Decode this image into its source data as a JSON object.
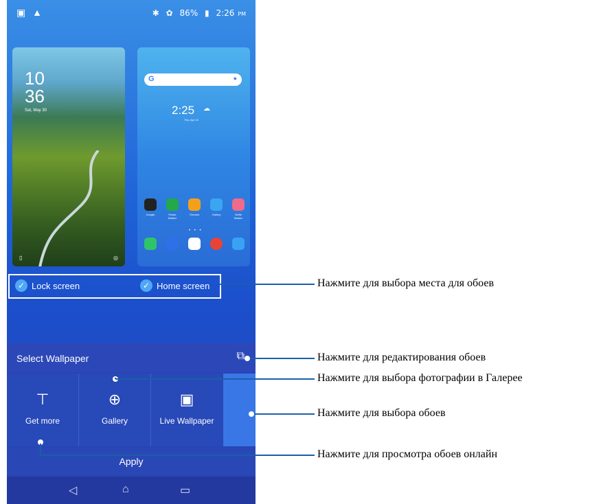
{
  "status_bar": {
    "left_icons": [
      "image-icon",
      "warning-icon"
    ],
    "battery": "86%",
    "time": "2:26",
    "time_suffix": "PM"
  },
  "lock_preview": {
    "time_line1": "10",
    "time_line2": "36",
    "date": "Sat, May 30"
  },
  "home_preview": {
    "time": "2:25",
    "date": "Thu, Apr 13",
    "apps_row1": [
      "Google",
      "Power Master",
      "Themes",
      "Gallery",
      "Selfie Master"
    ],
    "apps_row2": [
      "Phone",
      "Messages",
      "Play Store",
      "Chrome",
      "Camera"
    ]
  },
  "location_checks": [
    {
      "label": "Lock screen",
      "checked": true
    },
    {
      "label": "Home screen",
      "checked": true
    }
  ],
  "select_panel": {
    "title": "Select Wallpaper",
    "tiles": [
      "Get more",
      "Gallery",
      "Live Wallpaper"
    ],
    "apply_label": "Apply"
  },
  "annotations": {
    "location": "Нажмите для выбора места для обоев",
    "edit": "Нажмите для редактирования обоев",
    "gallery": "Нажмите для выбора фотографии в Галерее",
    "choose": "Нажмите для выбора обоев",
    "online": "Нажмите для просмотра обоев онлайн"
  },
  "colors": {
    "accent": "#1a5fa8",
    "check": "#4fa8f5",
    "panel": "#2944b5"
  }
}
